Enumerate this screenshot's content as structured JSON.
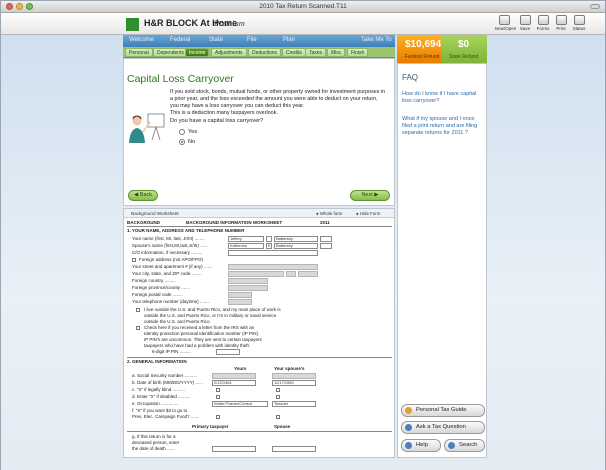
{
  "window": {
    "title": "2010 Tax Return Scanned.T11"
  },
  "app": {
    "brand": "H&R BLOCK At Home",
    "edition": "Premium"
  },
  "toolbar": {
    "buttons": [
      "New/Open",
      "Save",
      "Forms",
      "Print",
      "Status"
    ]
  },
  "nav": {
    "tabs": [
      "Welcome",
      "Federal",
      "State",
      "File",
      "Plan"
    ],
    "take_me_to": "Take Me To"
  },
  "subnav": {
    "items": [
      "Personal",
      "Dependents",
      "Income",
      "Adjustments",
      "Deductions",
      "Credits",
      "Taxes",
      "Misc",
      "Finish"
    ],
    "active_index": 2
  },
  "refund": {
    "federal_amount": "$10,694",
    "federal_label": "Federal Refund",
    "state_amount": "$0",
    "state_label": "State Refund"
  },
  "question_page": {
    "title": "Capital Loss Carryover",
    "intro_lines": [
      "If you sold stock, bonds, mutual funds, or other property owned for investment purposes in",
      "a prior year, and the loss exceeded the amount you were able to deduct on your return,",
      "you may have a loss carryover you can deduct this year."
    ],
    "note": "This is a deduction many taxpayers overlook.",
    "question": "Do you have a capital loss carryover?",
    "options": [
      "Yes",
      "No"
    ],
    "selected": "No",
    "back_label": "Back",
    "next_label": "Next"
  },
  "worksheet": {
    "name": "Background Worksheet",
    "view_whole": "Whole form",
    "view_hide": "Hide Form",
    "header_left": "BACKGROUND",
    "header_center": "BACKGROUND INFORMATION WORKSHEET",
    "header_year": "2011",
    "section1": "1.   YOUR NAME, ADDRESS AND TELEPHONE NUMBER",
    "rows": [
      "Your name (first, MI, last, Jr/III) ........",
      "Spouse's name (first,MI,last,Jr/III) ......",
      "C/O information, if necessary .........",
      "Foreign address (not APO/FPO)",
      "Your street and apartment # (if any) .......",
      "Your city, state, and ZIP code ........",
      "Foreign country .........",
      "Foreign province/county .......",
      "Foreign postal code ........",
      "Your telephone number (daytime) ........"
    ],
    "your_first": "Jeffery",
    "your_last": "Battersby",
    "spouse_first": "Katherine",
    "spouse_mi": "E",
    "spouse_last": "Battersby",
    "outside_us": [
      "I live outside the U.S. and Puerto Rico, and my main place of work is",
      "outside the U.S. and Puerto Rico, or I'm in military or naval service",
      "outside the U.S. and Puerto Rico."
    ],
    "ip_pin": [
      "Check here if you received a letter from the IRS with an",
      "Identity protection personal identification number (IP PIN).",
      "IP PIN's are uncommon. They are sent to certain taxpayers",
      "taxpayers who have had a problem with identity theft.",
      "6-digit IP PIN ........."
    ],
    "section2": "2.   GENERAL INFORMATION",
    "col_yours": "Yours",
    "col_spouse": "Your spouse's",
    "gen_rows": [
      "a.   Social Security number ..........",
      "b.   Date of birth (MM/DD/YYYY) ......",
      "c.   \"X\" if legally blind ..........",
      "d.   Enter \"X\" if disabled ..........",
      "e.   Occupation ..............",
      "f.   \"X\" if you want $3 to go to",
      "      Pres. Elec. Campaign Fund? ......"
    ],
    "dob_yours": "2/12/1961",
    "dob_spouse": "11/17/1960",
    "occ_yours": "Writer/Trainer/Consul",
    "occ_spouse": "Teacher",
    "col_primary": "Primary taxpayer",
    "col_spouse2": "Spouse",
    "g_rows": [
      "g.   If this return is for a",
      "      deceased person, enter",
      "      the date of death ......"
    ]
  },
  "faq": {
    "heading": "FAQ",
    "items": [
      "How do I know if I have capital loss carryover?",
      "What if my spouse and I once filed a joint return and are filing separate returns for 2011 ?"
    ],
    "buttons": [
      "Personal Tax Guide",
      "Ask a Tax Question",
      "Help",
      "Search"
    ]
  },
  "colors": {
    "nav_blue": "#3d7fb8",
    "subnav_green": "#9bc46e",
    "title_green": "#2f7a1c",
    "refund_orange": "#e77d00",
    "faq_link": "#2c6aa8"
  }
}
